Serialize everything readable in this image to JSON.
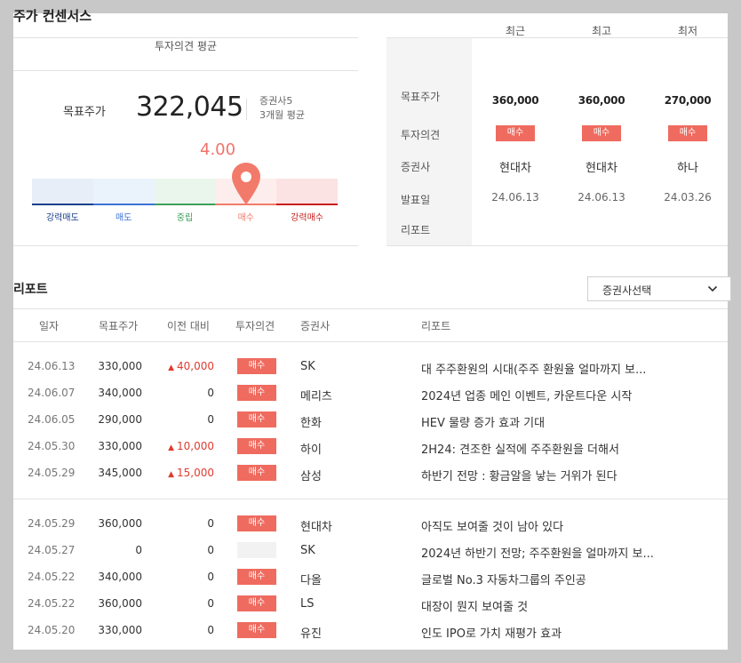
{
  "section_title": "주가 컨센서스",
  "average": {
    "header": "투자의견 평균",
    "target_label": "목표주가",
    "target_value": "322,045",
    "brokers_count": "증권사5",
    "period": "3개월 평균",
    "score": "4.00",
    "score_level": 4.0,
    "gauge_labels": [
      "강력매도",
      "매도",
      "중립",
      "매수",
      "강력매수"
    ],
    "gauge_colors": [
      "#1a3f8a",
      "#3b72d6",
      "#3ea05a",
      "#f27a6a",
      "#c81e1e"
    ]
  },
  "summary": {
    "columns": [
      "최근",
      "최고",
      "최저"
    ],
    "row_labels": [
      "목표주가",
      "투자의견",
      "증권사",
      "발표일",
      "리포트"
    ],
    "target": [
      "360,000",
      "360,000",
      "270,000"
    ],
    "opinion": [
      "매수",
      "매수",
      "매수"
    ],
    "broker": [
      "현대차",
      "현대차",
      "하나"
    ],
    "date": [
      "24.06.13",
      "24.06.13",
      "24.03.26"
    ]
  },
  "reports": {
    "title": "리포트",
    "select_label": "증권사선택",
    "headers": [
      "일자",
      "목표주가",
      "이전 대비",
      "투자의견",
      "증권사",
      "리포트"
    ],
    "rows": [
      {
        "date": "24.06.13",
        "target": "330,000",
        "diff": "40,000",
        "up": true,
        "opinion": "매수",
        "broker": "SK",
        "report": "대 주주환원의 시대(주주 환원율 얼마까지 보..."
      },
      {
        "date": "24.06.07",
        "target": "340,000",
        "diff": "0",
        "up": false,
        "opinion": "매수",
        "broker": "메리츠",
        "report": "2024년 업종 메인 이벤트, 카운트다운 시작"
      },
      {
        "date": "24.06.05",
        "target": "290,000",
        "diff": "0",
        "up": false,
        "opinion": "매수",
        "broker": "한화",
        "report": "HEV 물량 증가 효과 기대"
      },
      {
        "date": "24.05.30",
        "target": "330,000",
        "diff": "10,000",
        "up": true,
        "opinion": "매수",
        "broker": "하이",
        "report": "2H24: 견조한 실적에 주주환원을 더해서"
      },
      {
        "date": "24.05.29",
        "target": "345,000",
        "diff": "15,000",
        "up": true,
        "opinion": "매수",
        "broker": "삼성",
        "report": "하반기 전망 : 황금알을 낳는 거위가 된다"
      },
      {
        "date": "24.05.29",
        "target": "360,000",
        "diff": "0",
        "up": false,
        "opinion": "매수",
        "broker": "현대차",
        "report": "아직도 보여줄 것이 남아 있다"
      },
      {
        "date": "24.05.27",
        "target": "0",
        "diff": "0",
        "up": false,
        "opinion": "",
        "broker": "SK",
        "report": "2024년 하반기 전망; 주주환원을 얼마까지 보..."
      },
      {
        "date": "24.05.22",
        "target": "340,000",
        "diff": "0",
        "up": false,
        "opinion": "매수",
        "broker": "다올",
        "report": "글로벌 No.3 자동차그룹의 주인공"
      },
      {
        "date": "24.05.22",
        "target": "360,000",
        "diff": "0",
        "up": false,
        "opinion": "매수",
        "broker": "LS",
        "report": "대장이 뭔지 보여줄 것"
      },
      {
        "date": "24.05.20",
        "target": "330,000",
        "diff": "0",
        "up": false,
        "opinion": "매수",
        "broker": "유진",
        "report": "인도 IPO로 가치 재평가 효과"
      }
    ]
  }
}
